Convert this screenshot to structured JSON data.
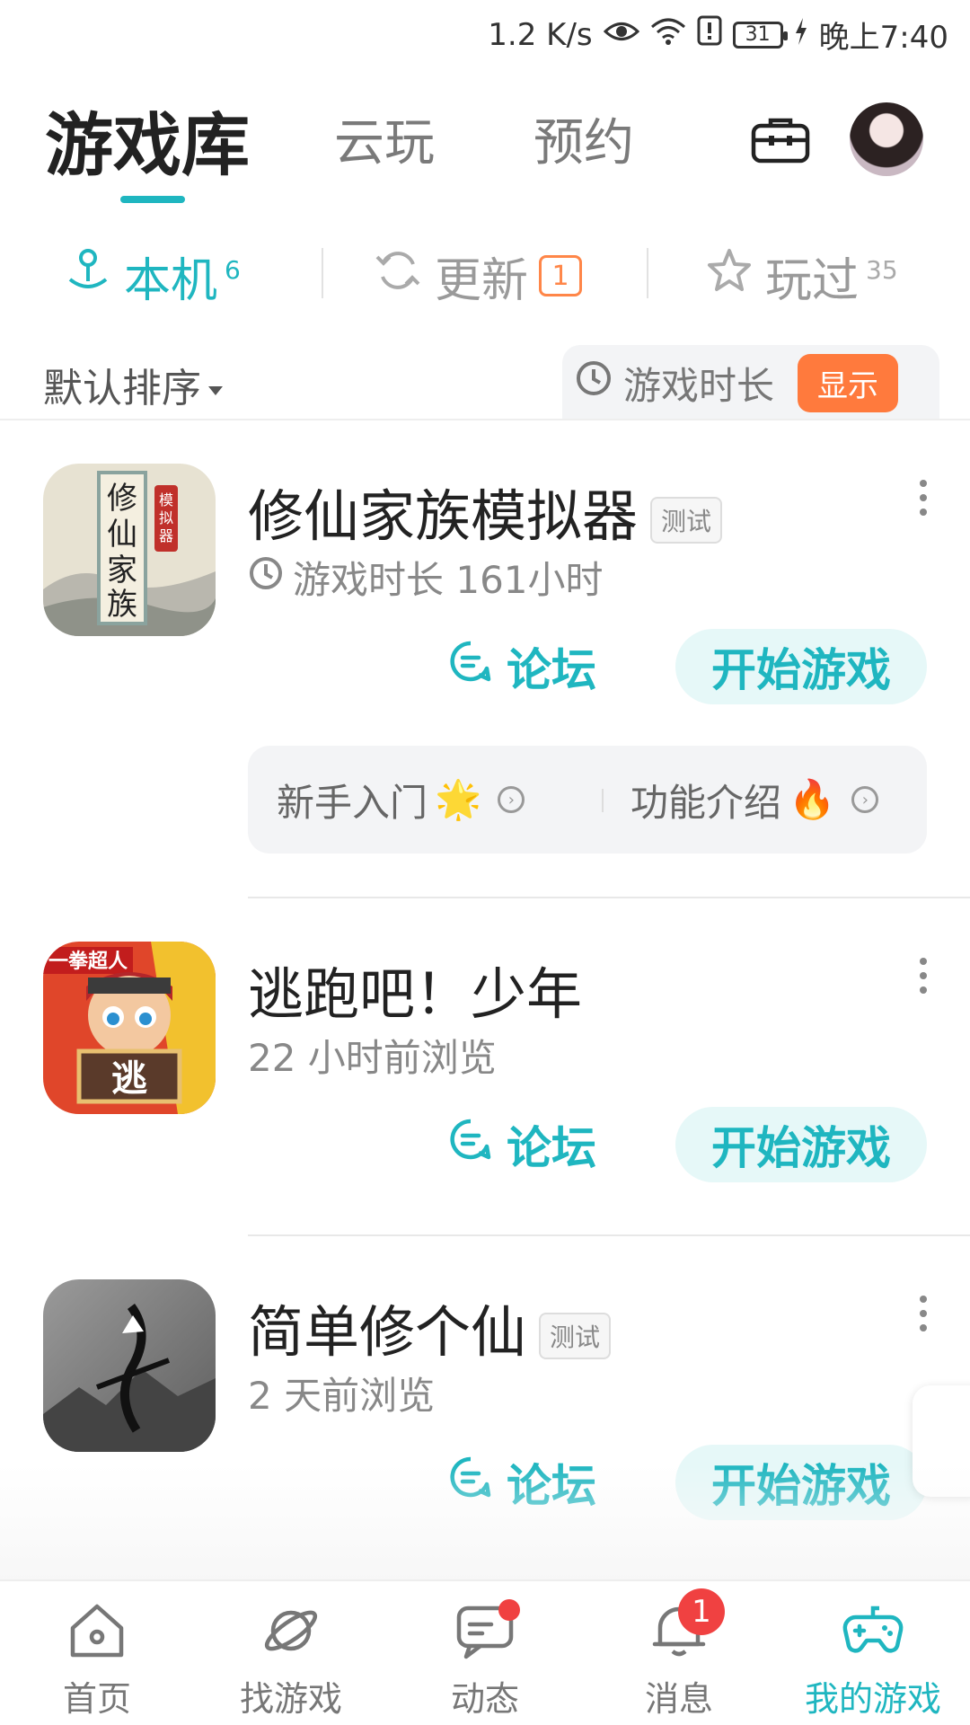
{
  "status_bar": {
    "speed": "1.2 K/s",
    "battery": "31",
    "time": "晚上7:40",
    "icons": [
      "eye-icon",
      "wifi-icon",
      "alert-icon",
      "battery-icon",
      "charging-icon"
    ]
  },
  "top_tabs": {
    "items": [
      "游戏库",
      "云玩",
      "预约"
    ],
    "active": "游戏库"
  },
  "sub_tabs": {
    "local": {
      "label": "本机",
      "count": "6"
    },
    "update": {
      "label": "更新",
      "badge": "1"
    },
    "played": {
      "label": "玩过",
      "count": "35"
    }
  },
  "sort": {
    "label": "默认排序",
    "duration_label": "游戏时长",
    "show_button": "显示"
  },
  "games": [
    {
      "title": "修仙家族模拟器",
      "tag": "测试",
      "subtitle": "游戏时长 161小时",
      "forum": "论坛",
      "start": "开始游戏",
      "guides": [
        {
          "label": "新手入门",
          "emoji": "🌟"
        },
        {
          "label": "功能介绍",
          "emoji": "🔥"
        }
      ]
    },
    {
      "title": "逃跑吧！少年",
      "subtitle": "22 小时前浏览",
      "forum": "论坛",
      "start": "开始游戏",
      "icon_text": "逃",
      "icon_top_text": "一拳超人"
    },
    {
      "title": "简单修个仙",
      "tag": "测试",
      "subtitle": "2 天前浏览",
      "forum": "论坛",
      "start": "开始游戏"
    }
  ],
  "bottom_nav": {
    "items": [
      {
        "label": "首页"
      },
      {
        "label": "找游戏"
      },
      {
        "label": "动态"
      },
      {
        "label": "消息",
        "badge": "1"
      },
      {
        "label": "我的游戏"
      }
    ],
    "active": "我的游戏"
  },
  "colors": {
    "accent": "#1fb6c0",
    "orange": "#ff7a3d",
    "badge_red": "#f04141"
  }
}
